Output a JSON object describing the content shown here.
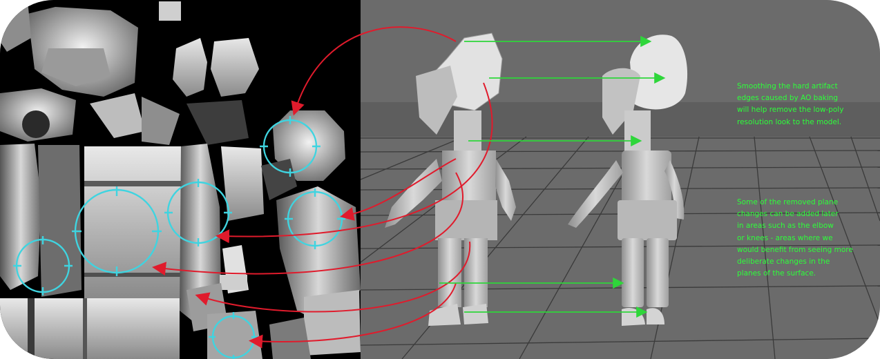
{
  "annotations": {
    "smoothing_note": "Smoothing the hard artifact\nedges caused by AO baking\nwill help remove the low-poly\nresolution look to the model.",
    "plane_changes_note": "Some of the removed plane\nchanges can be added later\nin areas such as the elbow\nor knees - areas where we\nwould benefit from seeing more\ndeliberate changes in the\nplanes of the surface."
  },
  "colors": {
    "frame_background": "#ffffff",
    "uv_background": "#000000",
    "viewport_background": "#6b6b6b",
    "grid_lines": "#3a3a3a",
    "highlight_circle": "#3fd4e0",
    "callout_arrow": "#e01b2c",
    "comparison_arrow": "#2ed63a",
    "note_text": "#2dff3a"
  },
  "icons": {
    "highlight": "crosshair-circle-icon",
    "callout": "curved-red-arrow-icon",
    "comparison": "green-arrow-icon"
  }
}
